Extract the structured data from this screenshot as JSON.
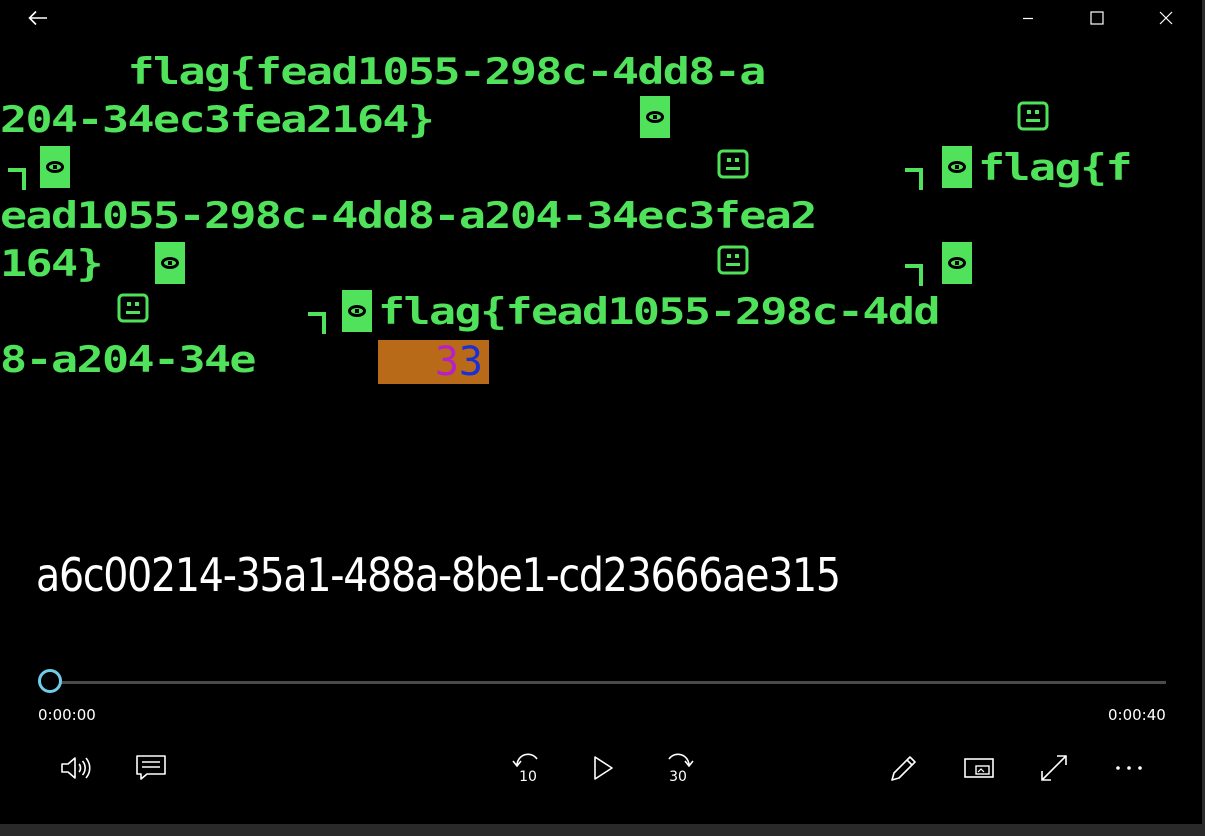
{
  "video": {
    "lines": [
      "     flag{fead1055-298c-4dd8-a",
      "204-34ec3fea2164}",
      "",
      "ead1055-298c-4dd8-a204-34ec3fea2",
      "164}",
      "",
      "8-a204-34e"
    ],
    "line3_tail": "flag{f",
    "line6_tail": "flag{fead1055-298c-4dd",
    "overlay_digits": [
      "3",
      "3"
    ]
  },
  "media": {
    "title": "a6c00214-35a1-488a-8be1-cd23666ae315"
  },
  "seek": {
    "current_time": "0:00:00",
    "total_time": "0:00:40",
    "progress": 0
  },
  "controls": {
    "skip_back_seconds": "10",
    "skip_forward_seconds": "30"
  },
  "colors": {
    "accent": "#6fcde8",
    "terminal_green": "#4fe25a",
    "overlay_orange": "#b86a18"
  },
  "icons": [
    "back-arrow-icon",
    "minimize-icon",
    "maximize-icon",
    "close-icon",
    "volume-icon",
    "captions-icon",
    "skip-back-10-icon",
    "play-icon",
    "skip-forward-30-icon",
    "edit-pencil-icon",
    "mini-view-icon",
    "fullscreen-icon",
    "more-options-icon"
  ]
}
